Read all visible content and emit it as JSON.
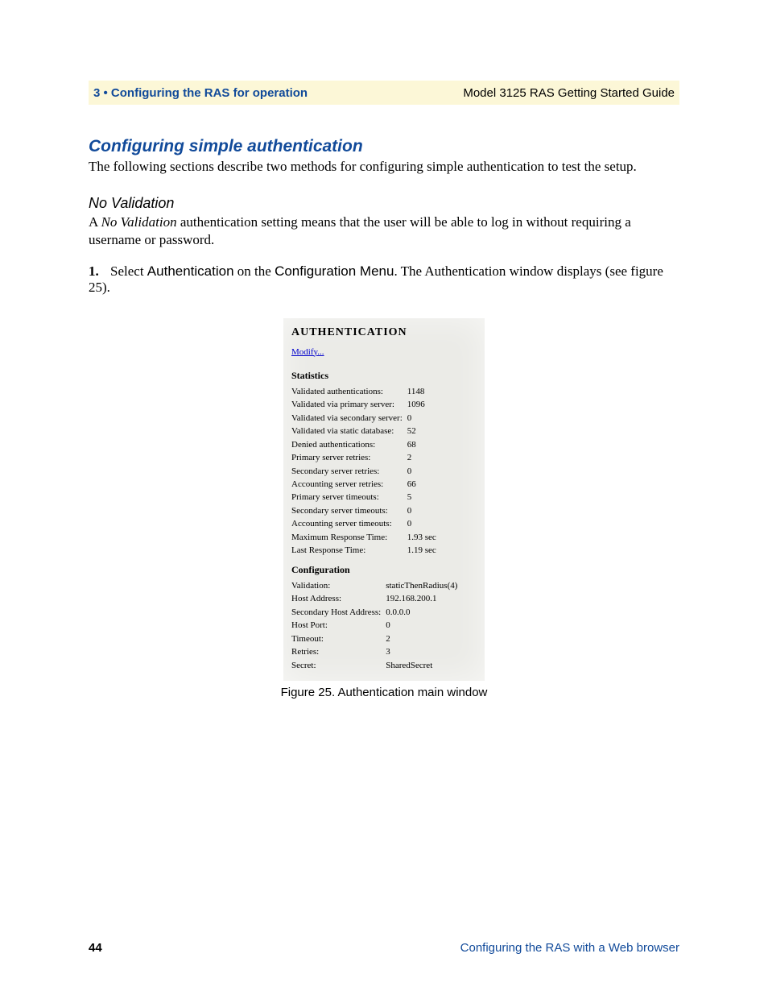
{
  "header": {
    "left": "3 • Configuring the RAS for operation",
    "right": "Model 3125 RAS Getting Started Guide"
  },
  "sectionTitle": "Configuring simple authentication",
  "introText": "The following sections describe two methods for configuring simple authentication to test the setup.",
  "subhead": "No Validation",
  "noval_prefix": "A ",
  "noval_italic": "No Validation",
  "noval_suffix": " authentication setting means that the user will be able to log in without requiring a username or password.",
  "step": {
    "num": "1.",
    "lead": "Select ",
    "w1": "Authentication",
    "mid1": " on the ",
    "w2": "Configuration Menu",
    "tail": ". The Authentication window displays (see figure 25)."
  },
  "figure": {
    "caption": "Figure 25. Authentication main window",
    "title": "AUTHENTICATION",
    "modify": "Modify...",
    "statsLabel": "Statistics",
    "configLabel": "Configuration",
    "stats": [
      {
        "k": "Validated authentications:",
        "v": "1148"
      },
      {
        "k": "Validated via primary server:",
        "v": "1096"
      },
      {
        "k": "Validated via secondary server:",
        "v": "0"
      },
      {
        "k": "Validated via static database:",
        "v": "52"
      },
      {
        "k": "Denied authentications:",
        "v": "68"
      },
      {
        "k": "Primary server retries:",
        "v": "2"
      },
      {
        "k": "Secondary server retries:",
        "v": "0"
      },
      {
        "k": "Accounting server retries:",
        "v": "66"
      },
      {
        "k": "Primary server timeouts:",
        "v": "5"
      },
      {
        "k": "Secondary server timeouts:",
        "v": "0"
      },
      {
        "k": "Accounting server timeouts:",
        "v": "0"
      },
      {
        "k": "Maximum Response Time:",
        "v": "1.93 sec"
      },
      {
        "k": "Last Response Time:",
        "v": "1.19 sec"
      }
    ],
    "config": [
      {
        "k": "Validation:",
        "v": "staticThenRadius(4)"
      },
      {
        "k": "Host Address:",
        "v": "192.168.200.1"
      },
      {
        "k": "Secondary Host Address:",
        "v": "0.0.0.0"
      },
      {
        "k": "Host Port:",
        "v": "0"
      },
      {
        "k": "Timeout:",
        "v": "2"
      },
      {
        "k": "Retries:",
        "v": "3"
      },
      {
        "k": "Secret:",
        "v": "SharedSecret"
      }
    ]
  },
  "footer": {
    "pageNum": "44",
    "right": "Configuring the RAS with a Web browser"
  }
}
